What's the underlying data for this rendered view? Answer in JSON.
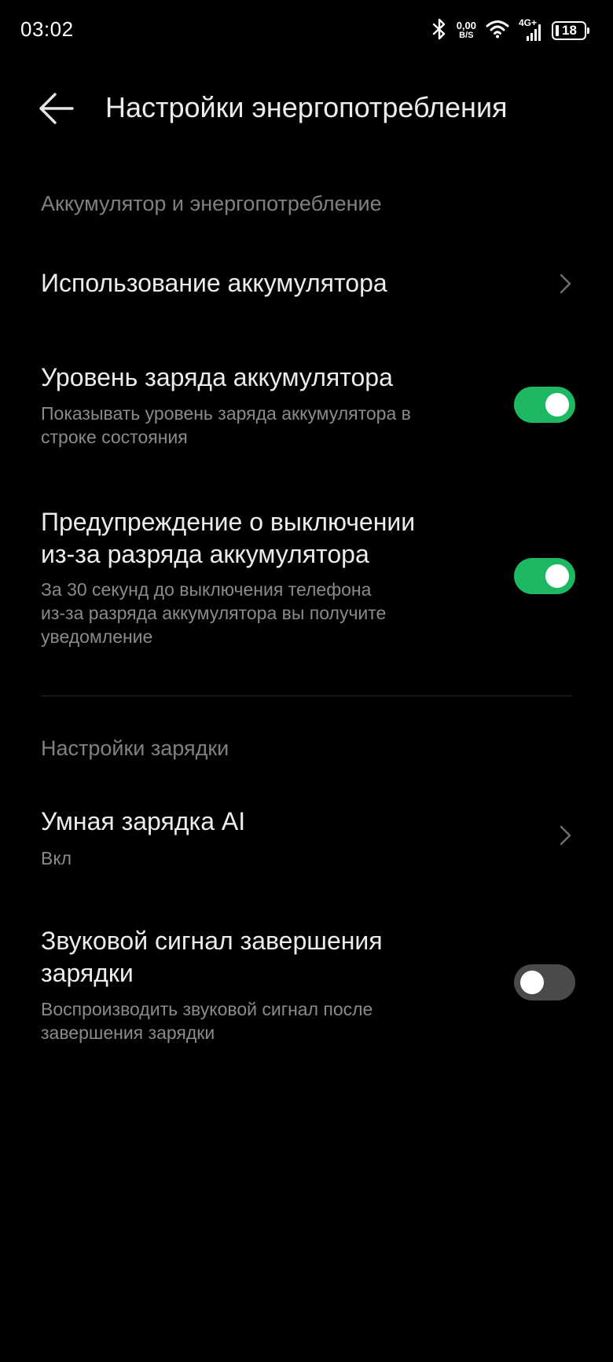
{
  "status_bar": {
    "time": "03:02",
    "net_speed_value": "0,00",
    "net_speed_unit": "B/S",
    "network_type": "4G+",
    "battery_level": "18",
    "icons": [
      "bluetooth-icon",
      "wifi-icon",
      "cellular-signal-icon",
      "battery-icon"
    ]
  },
  "header": {
    "title": "Настройки энергопотребления",
    "back_icon": "arrow-left-icon"
  },
  "sections": {
    "battery": {
      "header": "Аккумулятор и энергопотребление",
      "usage": {
        "title": "Использование аккумулятора"
      },
      "level": {
        "title": "Уровень заряда аккумулятора",
        "subtitle_line1": "Показывать уровень заряда аккумулятора в",
        "subtitle_line2": "строке состояния",
        "enabled": true
      },
      "low_warning": {
        "title_line1": "Предупреждение о выключении",
        "title_line2": "из-за разряда аккумулятора",
        "subtitle_line1": "За 30 секунд до выключения телефона",
        "subtitle_line2": "из-за разряда аккумулятора вы получите",
        "subtitle_line3": "уведомление",
        "enabled": true
      }
    },
    "charging": {
      "header": "Настройки зарядки",
      "smart": {
        "title": "Умная зарядка AI",
        "value": "Вкл"
      },
      "sound": {
        "title_line1": "Звуковой сигнал завершения",
        "title_line2": "зарядки",
        "subtitle_line1": "Воспроизводить звуковой сигнал после",
        "subtitle_line2": "завершения зарядки",
        "enabled": false
      }
    }
  },
  "colors": {
    "background": "#000000",
    "toggle_on": "#1fb862",
    "toggle_off": "#4a4a4a",
    "primary_text": "#ececec",
    "secondary_text": "#8a8a8a",
    "section_header": "#808080"
  }
}
